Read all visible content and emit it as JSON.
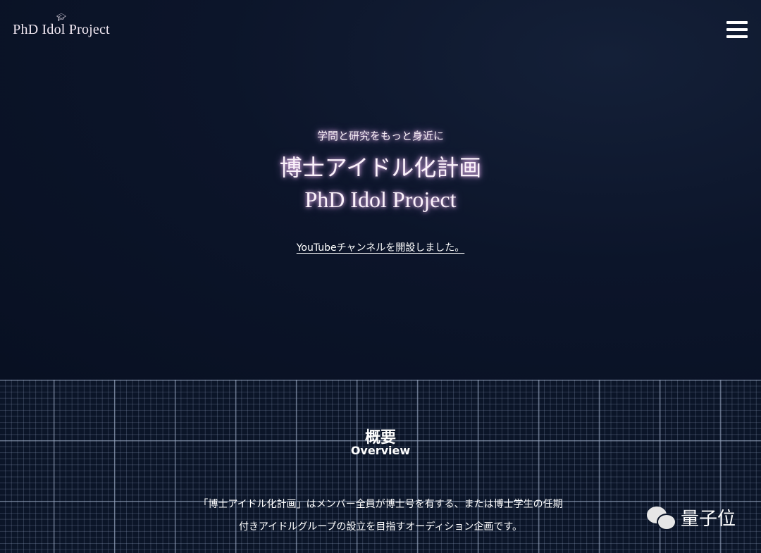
{
  "header": {
    "logo_text": "PhD Idol Project",
    "logo_icon": "graduation-cap-icon",
    "menu_icon": "hamburger-menu-icon"
  },
  "hero": {
    "subtitle": "学問と研究をもっと身近に",
    "title_jp": "博士アイドル化計画",
    "title_en": "PhD Idol Project",
    "youtube_link": "YouTubeチャンネルを開設しました。"
  },
  "overview": {
    "heading": "概要",
    "heading_en": "Overview",
    "description": "「博士アイドル化計画」はメンバー全員が博士号を有する、または博士学生の任期付きアイドルグループの設立を目指すオーディション企画です。"
  },
  "watermark": {
    "text": "量子位",
    "icon": "wechat-icon"
  }
}
